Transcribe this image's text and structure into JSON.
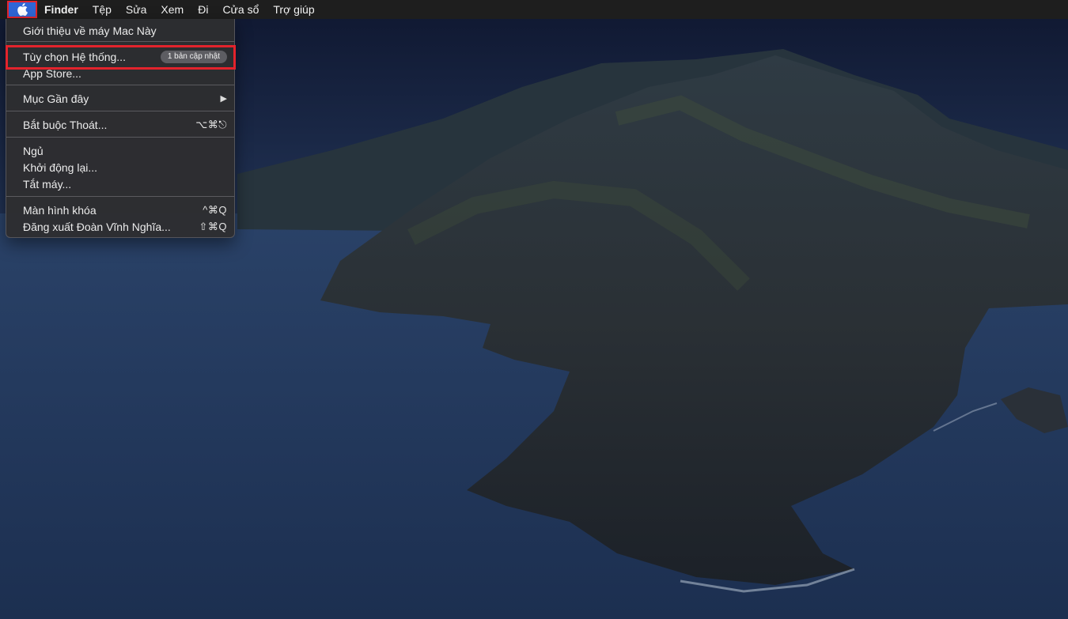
{
  "menubar": {
    "apple_icon": "apple-logo-icon",
    "items": [
      "Finder",
      "Tệp",
      "Sửa",
      "Xem",
      "Đi",
      "Cửa sổ",
      "Trợ giúp"
    ]
  },
  "apple_menu": {
    "about": "Giới thiệu về máy Mac Này",
    "system_prefs": "Tùy chọn Hệ thống...",
    "system_prefs_badge": "1 bản cập nhật",
    "app_store": "App Store...",
    "recent_items": "Mục Gần đây",
    "force_quit": "Bắt buộc Thoát...",
    "force_quit_shortcut": "⌥⌘⎋",
    "sleep": "Ngủ",
    "restart": "Khởi động lại...",
    "shutdown": "Tắt máy...",
    "lock_screen": "Màn hình khóa",
    "lock_screen_shortcut": "^⌘Q",
    "logout": "Đăng xuất Đoàn Vĩnh Nghĩa...",
    "logout_shortcut": "⇧⌘Q"
  },
  "colors": {
    "highlight": "#e3232c",
    "apple_button": "#2f66d6"
  }
}
